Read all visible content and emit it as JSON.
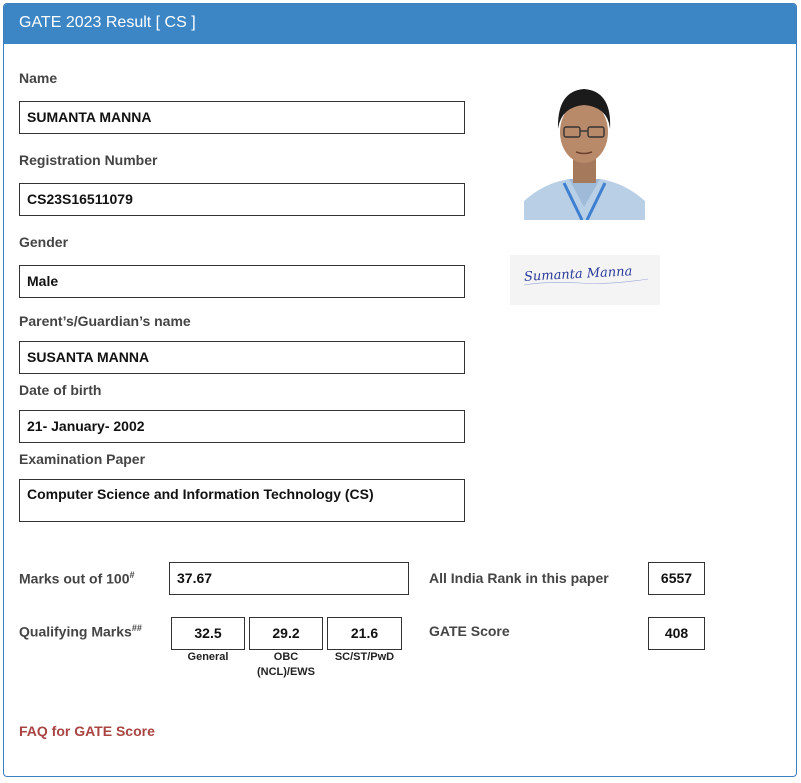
{
  "header": {
    "title": "GATE 2023 Result [ CS ]"
  },
  "fields": {
    "name": {
      "label": "Name",
      "value": "SUMANTA MANNA"
    },
    "registration": {
      "label": "Registration Number",
      "value": "CS23S16511079"
    },
    "gender": {
      "label": "Gender",
      "value": "Male"
    },
    "guardian": {
      "label": "Parent’s/Guardian’s name",
      "value": "SUSANTA MANNA"
    },
    "dob": {
      "label": "Date of birth",
      "value": "21- January- 2002"
    },
    "paper": {
      "label": "Examination Paper",
      "value": "Computer Science and Information Technology (CS)"
    }
  },
  "signature": {
    "text": "Sumanta Manna"
  },
  "scores": {
    "marks_label": "Marks out of 100",
    "marks_sup": "#",
    "marks_value": "37.67",
    "rank_label": "All India Rank in this paper",
    "rank_value": "6557",
    "qualifying_label": "Qualifying Marks",
    "qualifying_sup": "##",
    "qualifying": [
      {
        "value": "32.5",
        "caption_line1": "General",
        "caption_line2": ""
      },
      {
        "value": "29.2",
        "caption_line1": "OBC",
        "caption_line2": "(NCL)/EWS"
      },
      {
        "value": "21.6",
        "caption_line1": "SC/ST/PwD",
        "caption_line2": ""
      }
    ],
    "gate_score_label": "GATE Score",
    "gate_score_value": "408"
  },
  "links": {
    "faq": "FAQ for GATE Score"
  },
  "colors": {
    "header_bg": "#3d86c6",
    "link": "#a94442",
    "border": "#3a7fbf"
  }
}
